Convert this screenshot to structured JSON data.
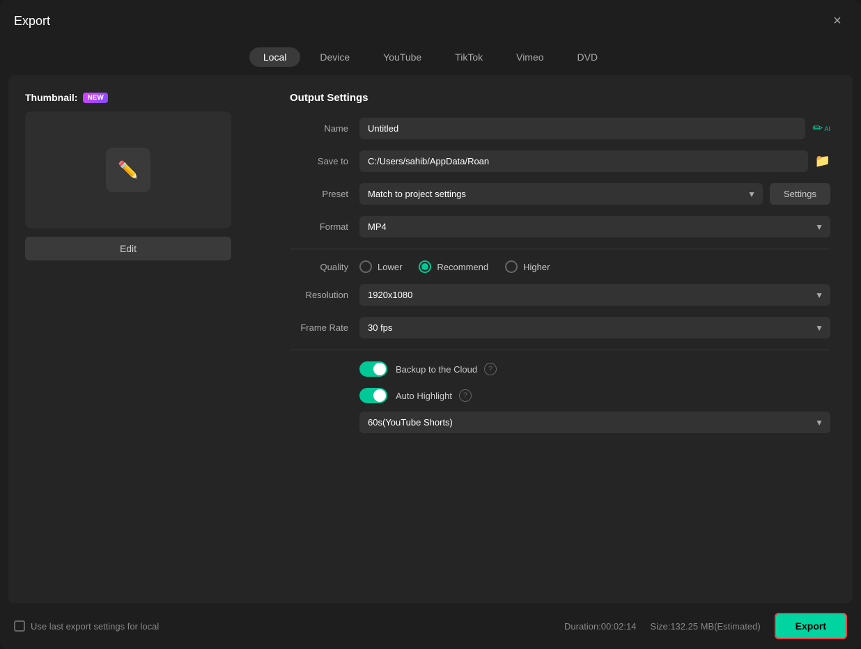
{
  "dialog": {
    "title": "Export",
    "close_label": "×"
  },
  "tabs": [
    {
      "id": "local",
      "label": "Local",
      "active": true
    },
    {
      "id": "device",
      "label": "Device",
      "active": false
    },
    {
      "id": "youtube",
      "label": "YouTube",
      "active": false
    },
    {
      "id": "tiktok",
      "label": "TikTok",
      "active": false
    },
    {
      "id": "vimeo",
      "label": "Vimeo",
      "active": false
    },
    {
      "id": "dvd",
      "label": "DVD",
      "active": false
    }
  ],
  "thumbnail": {
    "label": "Thumbnail:",
    "badge": "NEW",
    "edit_label": "Edit"
  },
  "output_settings": {
    "section_title": "Output Settings",
    "name_label": "Name",
    "name_value": "Untitled",
    "save_to_label": "Save to",
    "save_to_value": "C:/Users/sahib/AppData/Roan",
    "preset_label": "Preset",
    "preset_value": "Match to project settings",
    "settings_label": "Settings",
    "format_label": "Format",
    "format_value": "MP4",
    "quality_label": "Quality",
    "quality_options": [
      {
        "id": "lower",
        "label": "Lower",
        "checked": false
      },
      {
        "id": "recommend",
        "label": "Recommend",
        "checked": true
      },
      {
        "id": "higher",
        "label": "Higher",
        "checked": false
      }
    ],
    "resolution_label": "Resolution",
    "resolution_value": "1920x1080",
    "frame_rate_label": "Frame Rate",
    "frame_rate_value": "30 fps",
    "backup_label": "Backup to the Cloud",
    "backup_enabled": true,
    "auto_highlight_label": "Auto Highlight",
    "auto_highlight_enabled": true,
    "shorts_value": "60s(YouTube Shorts)"
  },
  "footer": {
    "checkbox_label": "Use last export settings for local",
    "duration_label": "Duration:",
    "duration_value": "00:02:14",
    "size_label": "Size:",
    "size_value": "132.25 MB(Estimated)",
    "export_label": "Export"
  }
}
